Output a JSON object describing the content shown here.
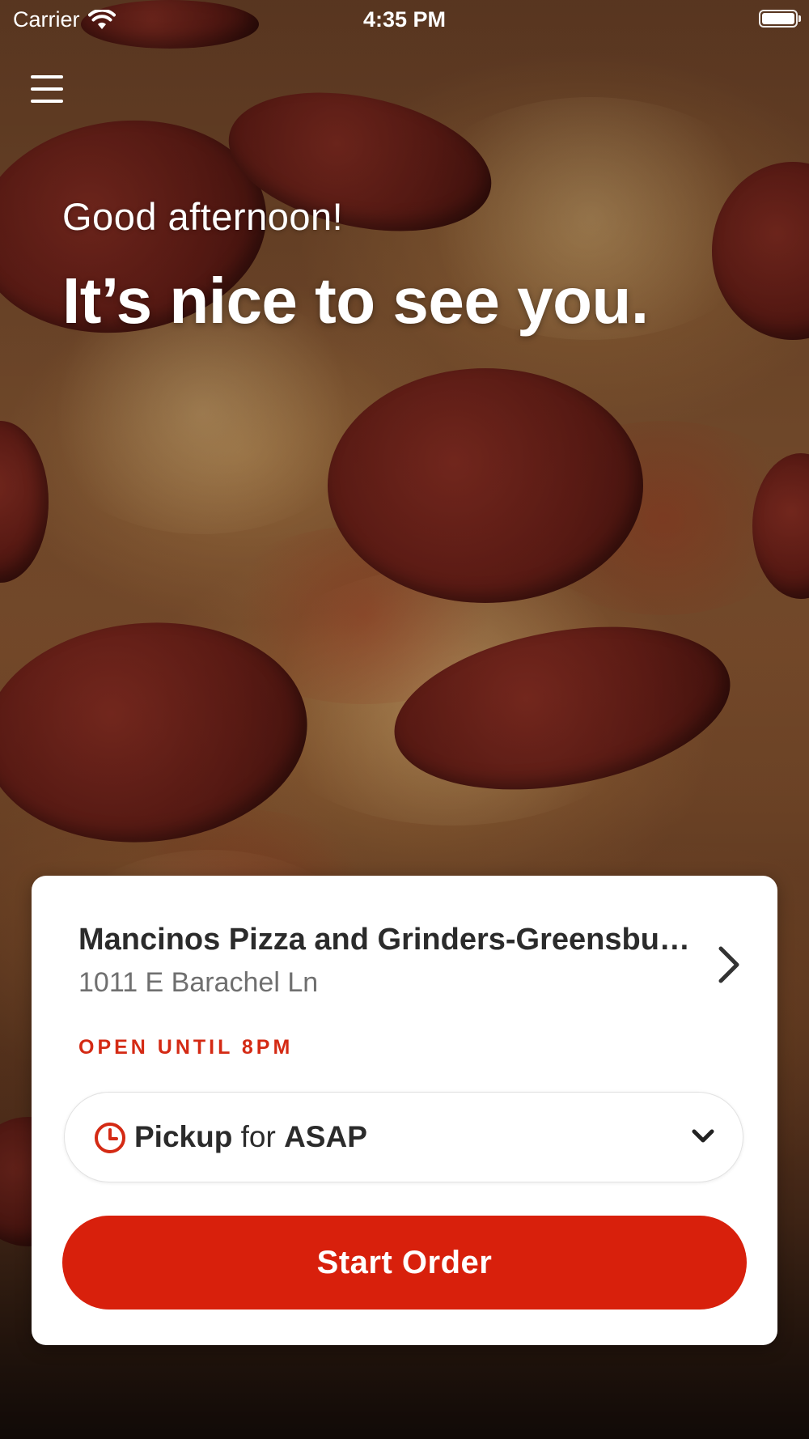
{
  "status_bar": {
    "carrier": "Carrier",
    "time": "4:35 PM",
    "icons": [
      "wifi-icon",
      "battery-icon"
    ]
  },
  "header": {
    "menu_icon": "hamburger-menu-icon"
  },
  "hero": {
    "greeting": "Good afternoon!",
    "headline": "It’s nice to see you."
  },
  "store_card": {
    "store_name": "Mancinos Pizza and Grinders-Greensbu…",
    "address": "1011 E Barachel Ln",
    "open_status": "OPEN UNTIL 8PM",
    "order_mode": {
      "mode": "Pickup",
      "connector": "for",
      "time": "ASAP",
      "icon": "clock-icon"
    },
    "start_button_label": "Start Order"
  },
  "colors": {
    "accent": "#d8200c",
    "status_red": "#d42a14",
    "card_bg": "#ffffff",
    "text_dark": "#2b2b2b",
    "text_muted": "#6f6f6f"
  }
}
